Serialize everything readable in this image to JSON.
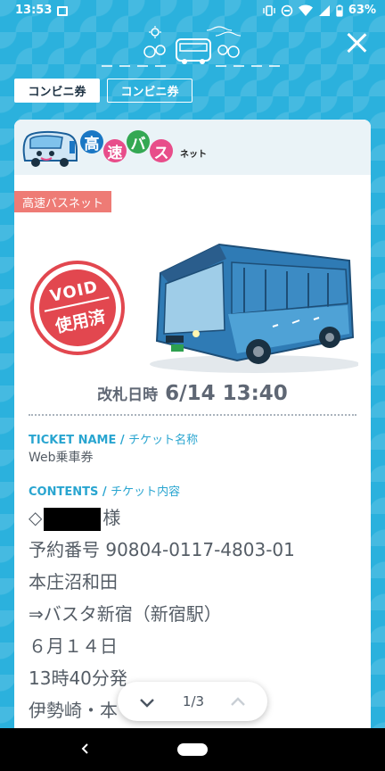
{
  "status_bar": {
    "time": "13:53",
    "battery": "63%",
    "icons": [
      "image-icon",
      "vibrate-icon",
      "dnd-icon",
      "wifi-icon",
      "signal-icon",
      "battery-icon"
    ]
  },
  "header": {
    "close_icon": "close-icon"
  },
  "tabs": [
    {
      "label": "コンビニ券",
      "active": true
    },
    {
      "label": "コンビニ券",
      "active": false
    }
  ],
  "card": {
    "logo": {
      "chars": [
        "高",
        "速",
        "バ",
        "ス"
      ],
      "suffix": "ネット"
    },
    "badge": "高速バスネット",
    "void_stamp": {
      "top": "VOID",
      "bottom": "使用済"
    },
    "gate": {
      "label": "改札日時",
      "value": "6/14 13:40"
    },
    "ticket_name": {
      "label_en": "TICKET NAME / ",
      "label_ja": "チケット名称",
      "value": "Web乗車券"
    },
    "contents": {
      "label_en": "CONTENTS / ",
      "label_ja": "チケット内容",
      "name_prefix": "◇",
      "name_suffix": "様",
      "lines": [
        "予約番号 90804-0117-4803-01",
        "本庄沼和田",
        "⇒バスタ新宿（新宿駅）",
        "６月１４日",
        "13時40分発",
        "伊勢崎・本"
      ]
    }
  },
  "pager": {
    "label": "1/3"
  },
  "colors": {
    "accent": "#2bb1dd",
    "stamp": "#e2474f",
    "badge": "#ee7b75",
    "label": "#29a5d0"
  }
}
